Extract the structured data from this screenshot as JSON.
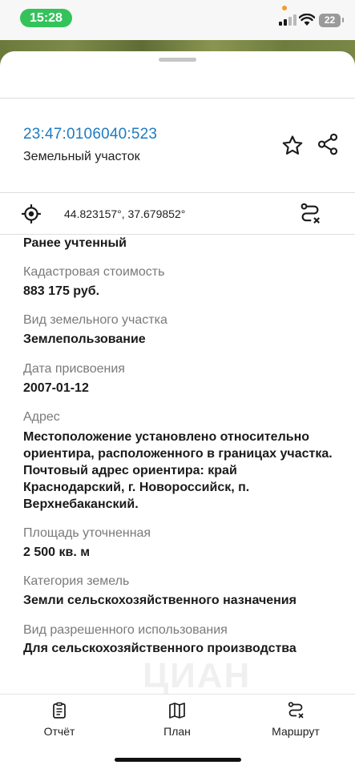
{
  "status_bar": {
    "time": "15:28",
    "battery": "22"
  },
  "header": {
    "cadastral_number": "23:47:0106040:523",
    "object_type": "Земельный участок",
    "favorite_icon": "star-icon",
    "share_icon": "share-icon"
  },
  "location": {
    "icon": "locate-icon",
    "coordinates": "44.823157°, 37.679852°",
    "route_icon": "route-icon"
  },
  "details": {
    "status_value": "Ранее учтенный",
    "fields": [
      {
        "label": "Кадастровая стоимость",
        "value": "883 175 руб."
      },
      {
        "label": "Вид земельного участка",
        "value": "Землепользование"
      },
      {
        "label": "Дата присвоения",
        "value": "2007-01-12"
      },
      {
        "label": "Адрес",
        "value": "Местоположение установлено относительно ориентира, расположенного в границах участка. Почтовый адрес ориентира: край Краснодарский, г. Новороссийск, п. Верхнебаканский."
      },
      {
        "label": "Площадь уточненная",
        "value": "2 500 кв. м"
      },
      {
        "label": "Категория земель",
        "value": "Земли сельскохозяйственного назначения"
      },
      {
        "label": "Вид разрешенного использования",
        "value": "Для сельскохозяйственного производства"
      }
    ]
  },
  "watermark": "ЦИАН",
  "tabbar": {
    "items": [
      {
        "label": "Отчёт",
        "icon": "report-icon"
      },
      {
        "label": "План",
        "icon": "map-icon"
      },
      {
        "label": "Маршрут",
        "icon": "route-icon"
      }
    ]
  },
  "colors": {
    "accent": "#1f7bc1",
    "status_pill": "#33c35a"
  }
}
